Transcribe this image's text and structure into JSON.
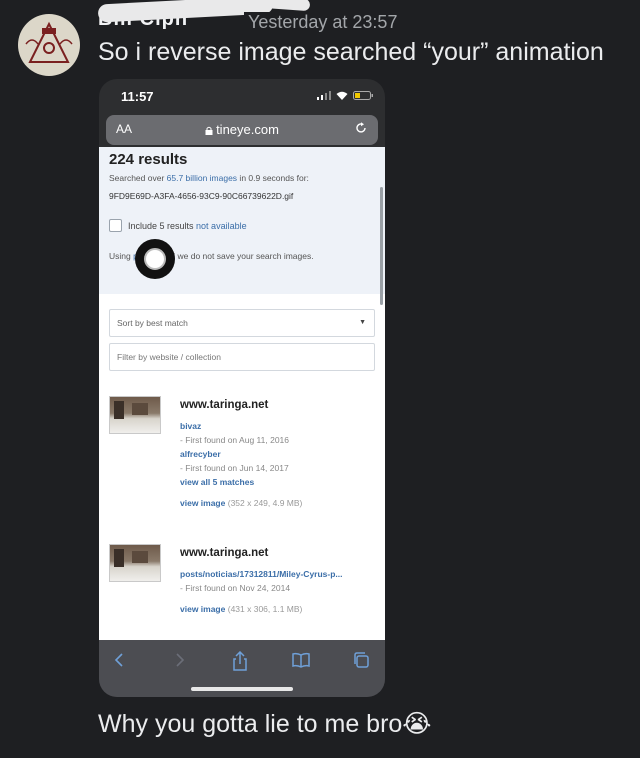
{
  "chat": {
    "username": "Bill Ciph",
    "timestamp": "Yesterday at 23:57",
    "message_1": "So i reverse image searched “your” animation",
    "message_2": "Why you gotta lie to me bro😭"
  },
  "phone": {
    "status_time": "11:57",
    "url_aa": "AA",
    "url": "tineye.com",
    "results": {
      "count_title": "224 results",
      "searched_prefix": "Searched over ",
      "searched_count": "65.7 billion images",
      "searched_suffix": " in 0.9 seconds for:",
      "filename": "9FD9E69D-A3FA-4656-93C9-90C66739622D.gif",
      "include_prefix": "Include 5 results ",
      "include_link": "not available",
      "private_prefix": "Using ",
      "private_link": "private",
      "private_suffix": " and we do not save your search images."
    },
    "sort_label": "Sort by best match",
    "filter_placeholder": "Filter by website / collection",
    "matches": [
      {
        "domain": "www.taringa.net",
        "entries": [
          {
            "text": "bivaz",
            "kind": "link"
          },
          {
            "text": "- First found on Aug 11, 2016",
            "kind": "meta"
          },
          {
            "text": "alfrecyber",
            "kind": "link"
          },
          {
            "text": "- First found on Jun 14, 2017",
            "kind": "meta"
          },
          {
            "text": "view all 5 matches",
            "kind": "link"
          }
        ],
        "view_label": "view image",
        "view_meta": "(352 x 249, 4.9 MB)"
      },
      {
        "domain": "www.taringa.net",
        "entries": [
          {
            "text": "posts/noticias/17312811/Miley-Cyrus-p...",
            "kind": "link"
          },
          {
            "text": "- First found on Nov 24, 2014",
            "kind": "meta"
          }
        ],
        "view_label": "view image",
        "view_meta": "(431 x 306, 1.1 MB)"
      }
    ],
    "toolbar_icons": [
      "back-icon",
      "forward-icon",
      "share-icon",
      "bookmarks-icon",
      "tabs-icon"
    ]
  },
  "colors": {
    "background": "#1e1f22",
    "message_text": "#ebecee",
    "timestamp": "#a3a6aa",
    "link": "#3b6ea8",
    "results_panel": "#eef2f8"
  }
}
